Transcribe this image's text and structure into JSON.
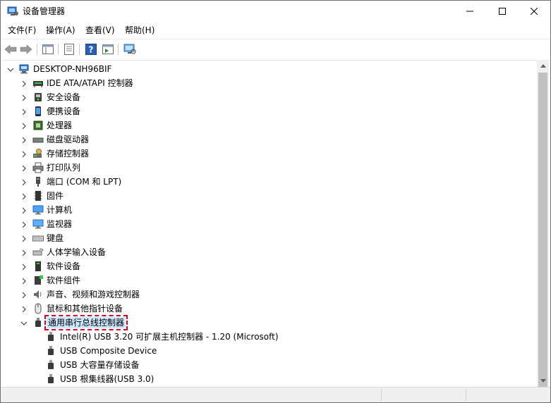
{
  "window": {
    "title": "设备管理器"
  },
  "menu": [
    {
      "label": "文件(F)"
    },
    {
      "label": "操作(A)"
    },
    {
      "label": "查看(V)"
    },
    {
      "label": "帮助(H)"
    }
  ],
  "tree": {
    "root": {
      "label": "DESKTOP-NH96BIF",
      "icon": "computer-icon"
    },
    "categories": [
      {
        "label": "IDE ATA/ATAPI 控制器",
        "icon": "ide-controller-icon"
      },
      {
        "label": "安全设备",
        "icon": "security-device-icon"
      },
      {
        "label": "便携设备",
        "icon": "portable-device-icon"
      },
      {
        "label": "处理器",
        "icon": "processor-icon"
      },
      {
        "label": "磁盘驱动器",
        "icon": "disk-drive-icon"
      },
      {
        "label": "存储控制器",
        "icon": "storage-controller-icon"
      },
      {
        "label": "打印队列",
        "icon": "printer-icon"
      },
      {
        "label": "端口 (COM 和 LPT)",
        "icon": "port-icon"
      },
      {
        "label": "固件",
        "icon": "firmware-icon"
      },
      {
        "label": "计算机",
        "icon": "computer-monitor-icon"
      },
      {
        "label": "监视器",
        "icon": "monitor-icon"
      },
      {
        "label": "键盘",
        "icon": "keyboard-icon"
      },
      {
        "label": "人体学输入设备",
        "icon": "hid-icon"
      },
      {
        "label": "软件设备",
        "icon": "software-device-icon"
      },
      {
        "label": "软件组件",
        "icon": "software-component-icon"
      },
      {
        "label": "声音、视频和游戏控制器",
        "icon": "sound-icon"
      },
      {
        "label": "鼠标和其他指针设备",
        "icon": "mouse-icon"
      },
      {
        "label": "通用串行总线控制器",
        "icon": "usb-icon",
        "expanded": true,
        "highlighted": true
      }
    ],
    "usb_children": [
      {
        "label": "Intel(R) USB 3.20 可扩展主机控制器 - 1.20 (Microsoft)",
        "icon": "usb-plug-icon"
      },
      {
        "label": "USB Composite Device",
        "icon": "usb-plug-icon"
      },
      {
        "label": "USB 大容量存储设备",
        "icon": "usb-plug-icon"
      },
      {
        "label": "USB 根集线器(USB 3.0)",
        "icon": "usb-plug-icon"
      }
    ]
  },
  "colors": {
    "highlight_outline": "#e0001a",
    "selection_bg": "#cce8ff",
    "scrollbar_thumb": "#c1c1c1"
  }
}
